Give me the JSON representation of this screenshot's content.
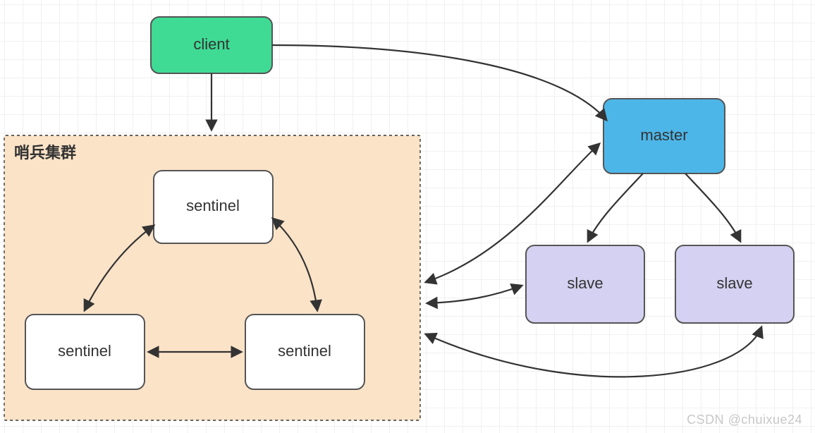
{
  "watermark": "CSDN @chuixue24",
  "cluster": {
    "label": "哨兵集群"
  },
  "nodes": {
    "client": {
      "label": "client",
      "fill": "#3fdb94"
    },
    "master": {
      "label": "master",
      "fill": "#4db6e8"
    },
    "slave1": {
      "label": "slave",
      "fill": "#d4d1f2"
    },
    "slave2": {
      "label": "slave",
      "fill": "#d4d1f2"
    },
    "sentinelTop": {
      "label": "sentinel",
      "fill": "#ffffff"
    },
    "sentinelLeft": {
      "label": "sentinel",
      "fill": "#ffffff"
    },
    "sentinelRight": {
      "label": "sentinel",
      "fill": "#ffffff"
    }
  }
}
